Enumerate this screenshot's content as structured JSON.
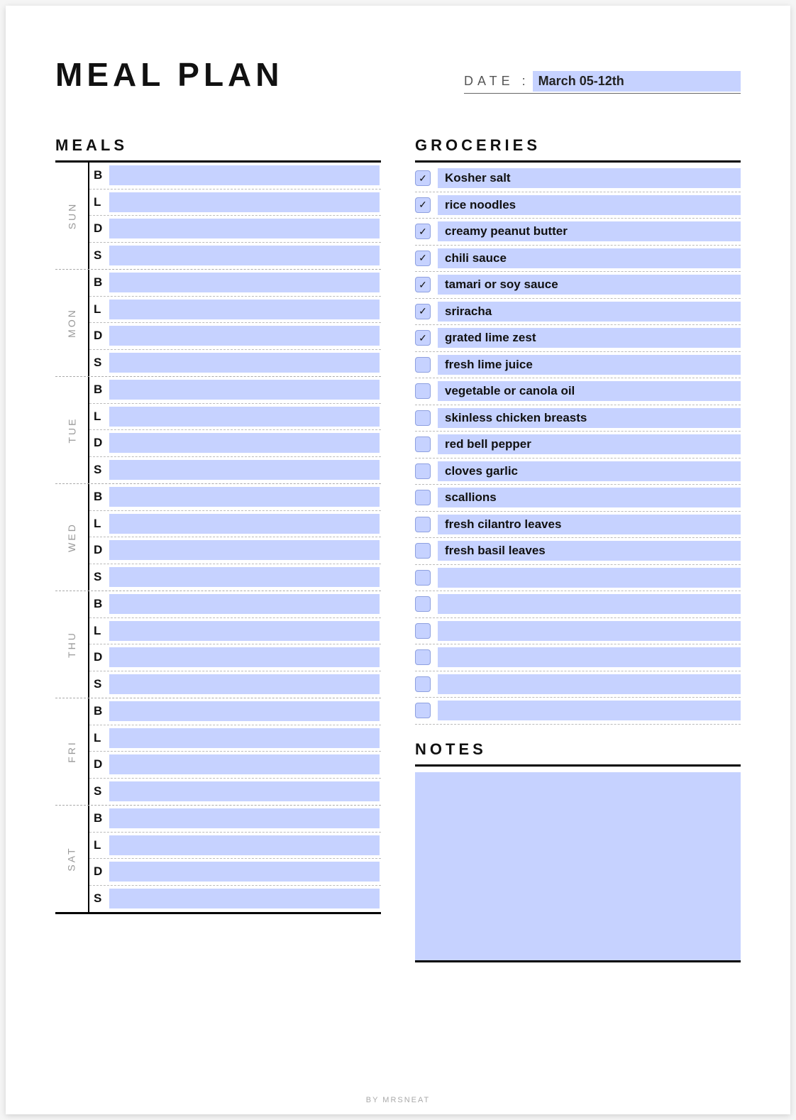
{
  "title": "MEAL PLAN",
  "date_label": "DATE :",
  "date_value": "March 05-12th",
  "meals_heading": "MEALS",
  "groceries_heading": "GROCERIES",
  "notes_heading": "NOTES",
  "footer": "BY MRSNEAT",
  "meal_types": [
    "B",
    "L",
    "D",
    "S"
  ],
  "days": [
    {
      "label": "SUN",
      "cells": [
        "",
        "",
        "",
        ""
      ]
    },
    {
      "label": "MON",
      "cells": [
        "",
        "",
        "",
        ""
      ]
    },
    {
      "label": "TUE",
      "cells": [
        "",
        "",
        "",
        ""
      ]
    },
    {
      "label": "WED",
      "cells": [
        "",
        "",
        "",
        ""
      ]
    },
    {
      "label": "THU",
      "cells": [
        "",
        "",
        "",
        ""
      ]
    },
    {
      "label": "FRI",
      "cells": [
        "",
        "",
        "",
        ""
      ]
    },
    {
      "label": "SAT",
      "cells": [
        "",
        "",
        "",
        ""
      ]
    }
  ],
  "groceries": [
    {
      "checked": true,
      "item": "Kosher salt"
    },
    {
      "checked": true,
      "item": "rice noodles"
    },
    {
      "checked": true,
      "item": "creamy peanut butter"
    },
    {
      "checked": true,
      "item": "chili sauce"
    },
    {
      "checked": true,
      "item": "tamari or soy sauce"
    },
    {
      "checked": true,
      "item": "sriracha"
    },
    {
      "checked": true,
      "item": "grated lime zest"
    },
    {
      "checked": false,
      "item": "fresh lime juice"
    },
    {
      "checked": false,
      "item": "vegetable or canola oil"
    },
    {
      "checked": false,
      "item": "skinless chicken breasts"
    },
    {
      "checked": false,
      "item": "red bell pepper"
    },
    {
      "checked": false,
      "item": "cloves garlic"
    },
    {
      "checked": false,
      "item": "scallions"
    },
    {
      "checked": false,
      "item": "fresh cilantro leaves"
    },
    {
      "checked": false,
      "item": "fresh basil leaves"
    },
    {
      "checked": false,
      "item": ""
    },
    {
      "checked": false,
      "item": ""
    },
    {
      "checked": false,
      "item": ""
    },
    {
      "checked": false,
      "item": ""
    },
    {
      "checked": false,
      "item": ""
    },
    {
      "checked": false,
      "item": ""
    }
  ],
  "notes": ""
}
